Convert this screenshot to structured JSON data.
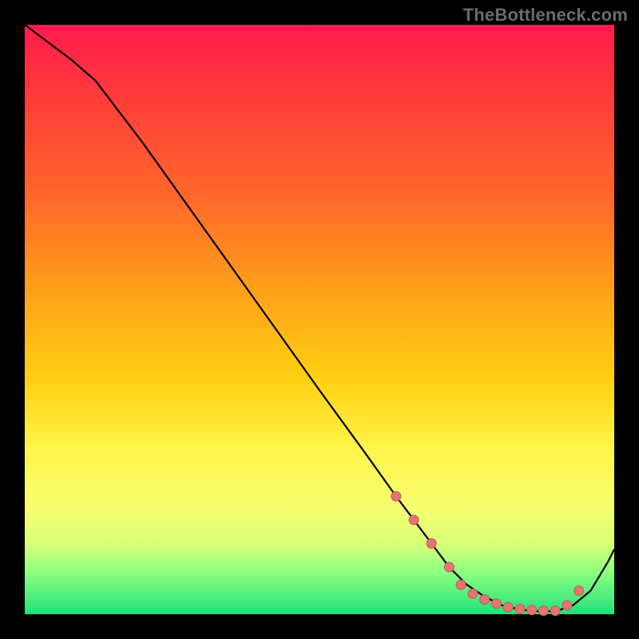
{
  "watermark": "TheBottleneck.com",
  "chart_data": {
    "type": "line",
    "title": "",
    "xlabel": "",
    "ylabel": "",
    "xlim": [
      0,
      100
    ],
    "ylim": [
      0,
      100
    ],
    "grid": false,
    "legend": false,
    "series": [
      {
        "name": "bottleneck-curve",
        "x": [
          0,
          4,
          8,
          12,
          20,
          30,
          40,
          50,
          58,
          63,
          66,
          69,
          72,
          75,
          78,
          81,
          84,
          87,
          90,
          93,
          96,
          99,
          100
        ],
        "y": [
          100,
          97,
          94,
          90.5,
          80,
          66,
          52,
          38,
          27,
          20,
          16,
          12,
          8,
          5,
          3,
          1.5,
          0.8,
          0.5,
          0.5,
          1.5,
          4,
          9,
          11
        ]
      }
    ],
    "highlight_points": {
      "name": "optimal-range-dots",
      "x": [
        63,
        66,
        69,
        72,
        74,
        76,
        78,
        80,
        82,
        84,
        86,
        88,
        90,
        92,
        94
      ],
      "y": [
        20,
        16,
        12,
        8,
        5,
        3.5,
        2.5,
        1.8,
        1.2,
        0.9,
        0.7,
        0.6,
        0.6,
        1.5,
        4
      ],
      "color": "#e57373"
    },
    "colors": {
      "curve": "#000000",
      "dots": "#e57373",
      "gradient_top": "#ff1a4d",
      "gradient_mid": "#ffe13a",
      "gradient_bottom": "#22e07a",
      "frame": "#000000"
    }
  }
}
